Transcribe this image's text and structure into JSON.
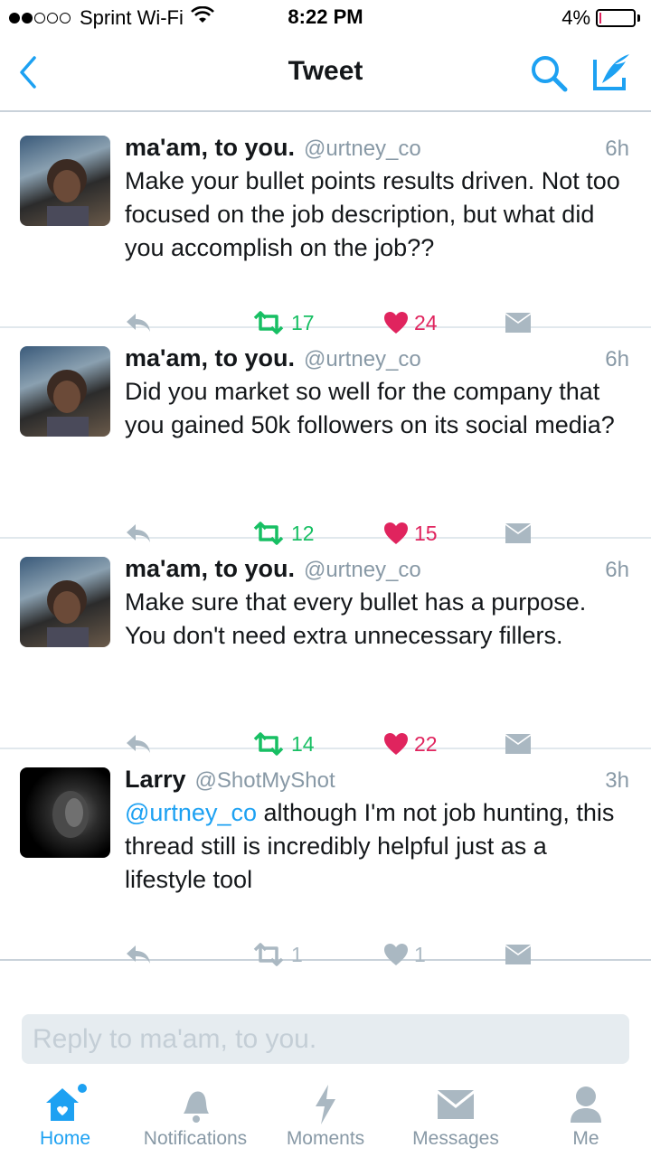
{
  "status_bar": {
    "carrier": "Sprint Wi-Fi",
    "time": "8:22 PM",
    "battery": "4%",
    "battery_level": 0.04,
    "signal_bars": 2
  },
  "nav": {
    "title": "Tweet"
  },
  "tweets": [
    {
      "name": "ma'am, to you.",
      "handle": "@urtney_co",
      "time": "6h",
      "text": "Make your bullet points results driven. Not too focused on the job description, but what did you accomplish on the job??",
      "retweets": "17",
      "likes": "24"
    },
    {
      "name": "ma'am, to you.",
      "handle": "@urtney_co",
      "time": "6h",
      "text": "Did you market so well for the company that you gained 50k followers on its social media?",
      "retweets": "12",
      "likes": "15"
    },
    {
      "name": "ma'am, to you.",
      "handle": "@urtney_co",
      "time": "6h",
      "text": "Make sure that every bullet has a purpose. You don't need extra unnecessary fillers.",
      "retweets": "14",
      "likes": "22"
    },
    {
      "name": "Larry",
      "handle": "@ShotMyShot",
      "time": "3h",
      "mention": "@urtney_co",
      "text": " although I'm not job hunting, this thread still is incredibly helpful just as a lifestyle tool",
      "retweets": "1",
      "likes": "1"
    }
  ],
  "reply": {
    "placeholder": "Reply to ma'am, to you."
  },
  "tabs": [
    {
      "label": "Home",
      "icon": "home-icon"
    },
    {
      "label": "Notifications",
      "icon": "bell-icon"
    },
    {
      "label": "Moments",
      "icon": "lightning-icon"
    },
    {
      "label": "Messages",
      "icon": "envelope-icon"
    },
    {
      "label": "Me",
      "icon": "person-icon"
    }
  ],
  "colors": {
    "accent": "#1da1f2",
    "retweet": "#17bf63",
    "like": "#e0245e",
    "muted": "#8899a6"
  }
}
